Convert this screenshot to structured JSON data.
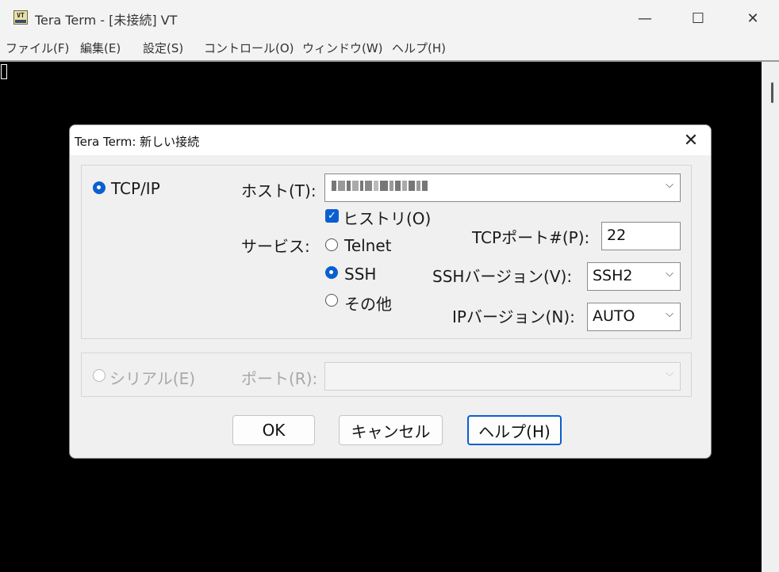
{
  "window": {
    "icon_text": "VT",
    "title": "Tera Term - [未接続] VT",
    "minimize": "—",
    "maximize": "☐",
    "close": "✕"
  },
  "menu": [
    "ファイル(F)",
    "編集(E)",
    "設定(S)",
    "コントロール(O)",
    "ウィンドウ(W)",
    "ヘルプ(H)"
  ],
  "dialog": {
    "title": "Tera Term: 新しい接続",
    "close": "✕",
    "tcpip": {
      "radio_label": "TCP/IP",
      "host_label": "ホスト(T):",
      "host_value": "",
      "history_label": "ヒストリ(O)",
      "history_checked": true,
      "service_label": "サービス:",
      "services": [
        "Telnet",
        "SSH",
        "その他"
      ],
      "selected_service": "SSH",
      "tcp_port_label": "TCPポート#(P):",
      "tcp_port_value": "22",
      "ssh_version_label": "SSHバージョン(V):",
      "ssh_version_value": "SSH2",
      "ip_version_label": "IPバージョン(N):",
      "ip_version_value": "AUTO"
    },
    "serial": {
      "radio_label": "シリアル(E)",
      "port_label": "ポート(R):",
      "port_value": ""
    },
    "buttons": {
      "ok": "OK",
      "cancel": "キャンセル",
      "help": "ヘルプ(H)"
    }
  },
  "colors": {
    "accent": "#0a5fd0",
    "terminal_bg": "#000000"
  }
}
